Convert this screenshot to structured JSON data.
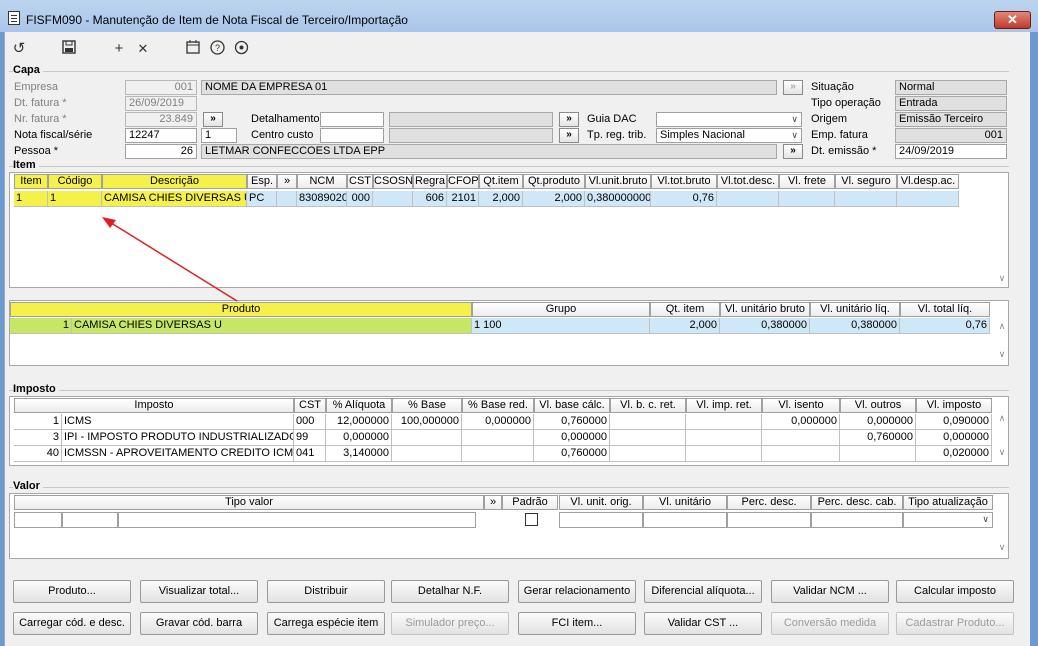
{
  "window": {
    "title": "FISFM090 - Manutenção de Item de Nota Fiscal de Terceiro/Importação",
    "close": "✕"
  },
  "toolbar": {
    "undo": "↺",
    "save": "💾",
    "add": "+",
    "remove": "✕",
    "calendar": "▦",
    "help": "?",
    "settings": "⚙"
  },
  "capa": {
    "title": "Capa",
    "empresa_label": "Empresa",
    "empresa_code": "001",
    "empresa_name": "NOME DA EMPRESA 01",
    "dt_fatura_label": "Dt. fatura *",
    "dt_fatura": "26/09/2019",
    "nr_fatura_label": "Nr. fatura *",
    "nr_fatura": "23.849",
    "nota_label": "Nota fiscal/série",
    "nota": "12247",
    "serie": "1",
    "pessoa_label": "Pessoa *",
    "pessoa_code": "26",
    "pessoa_name": "LETMAR CONFECCOES LTDA EPP",
    "detalhamento_label": "Detalhamento",
    "centro_custo_label": "Centro custo",
    "guia_dac_label": "Guia DAC",
    "tp_reg_label": "Tp. reg. trib.",
    "tp_reg": "Simples Nacional",
    "situacao_label": "Situação",
    "situacao": "Normal",
    "tipo_op_label": "Tipo operação",
    "tipo_op": "Entrada",
    "origem_label": "Origem",
    "origem": "Emissão Terceiro",
    "emp_fatura_label": "Emp. fatura",
    "emp_fatura": "001",
    "dt_emissao_label": "Dt. emissão *",
    "dt_emissao": "24/09/2019",
    "btn_more": "»",
    "btn_gray": "»"
  },
  "item": {
    "title": "Item",
    "headers": [
      "Item",
      "Código",
      "Descrição",
      "Esp.",
      "»",
      "NCM",
      "CST",
      "CSOSN",
      "Regra",
      "CFOP",
      "Qt.item",
      "Qt.produto",
      "Vl.unit.bruto",
      "Vl.tot.bruto",
      "Vl.tot.desc.",
      "Vl. frete",
      "Vl. seguro",
      "Vl.desp.ac."
    ],
    "row": [
      "1",
      "1",
      "CAMISA CHIES DIVERSAS U",
      "PC",
      "",
      "83089020",
      "000",
      "",
      "606",
      "2101",
      "2,000",
      "2,000",
      "0,380000000",
      "0,76",
      "",
      "",
      "",
      ""
    ]
  },
  "produto": {
    "headers": [
      "Produto",
      "Grupo",
      "Qt. item",
      "Vl. unitário bruto",
      "Vl. unitário líq.",
      "Vl. total líq."
    ],
    "row": [
      "1",
      "CAMISA CHIES DIVERSAS U",
      "1 100",
      "2,000",
      "0,380000",
      "0,380000",
      "0,76"
    ]
  },
  "imposto": {
    "title": "Imposto",
    "headers": [
      "Imposto",
      "CST",
      "% Alíquota",
      "% Base",
      "% Base red.",
      "Vl. base cálc.",
      "Vl. b. c. ret.",
      "Vl. imp. ret.",
      "Vl. isento",
      "Vl. outros",
      "Vl. imposto"
    ],
    "rows": [
      [
        "1",
        "ICMS",
        "000",
        "12,000000",
        "100,000000",
        "0,000000",
        "0,760000",
        "",
        "",
        "0,000000",
        "0,000000",
        "0,090000"
      ],
      [
        "3",
        "IPI - IMPOSTO PRODUTO INDUSTRIALIZADO",
        "99",
        "0,000000",
        "",
        "",
        "0,000000",
        "",
        "",
        "",
        "0,760000",
        "0,000000"
      ],
      [
        "40",
        "ICMSSN - APROVEITAMENTO CREDITO ICMS SIM",
        "041",
        "3,140000",
        "",
        "",
        "0,760000",
        "",
        "",
        "",
        "",
        "0,020000"
      ]
    ]
  },
  "valor": {
    "title": "Valor",
    "headers": [
      "Tipo valor",
      "»",
      "Padrão",
      "Vl. unit. orig.",
      "Vl. unitário",
      "Perc. desc.",
      "Perc. desc. cab.",
      "Tipo atualização"
    ]
  },
  "buttons": {
    "row1": [
      "Produto...",
      "Visualizar total...",
      "Distribuir",
      "Detalhar N.F.",
      "Gerar relacionamento",
      "Diferencial alíquota...",
      "Validar NCM ...",
      "Calcular imposto"
    ],
    "row2": [
      "Carregar cód. e desc.",
      "Gravar cód. barra",
      "Carrega espécie item",
      "Simulador preço...",
      "FCI item...",
      "Validar CST ...",
      "Conversão medida",
      "Cadastrar Produto..."
    ]
  },
  "colors": {
    "highlight_yellow": "#f5f04a",
    "row_blue": "#cfe8f7",
    "row_green": "#c6e766",
    "arrow": "#e02020"
  }
}
